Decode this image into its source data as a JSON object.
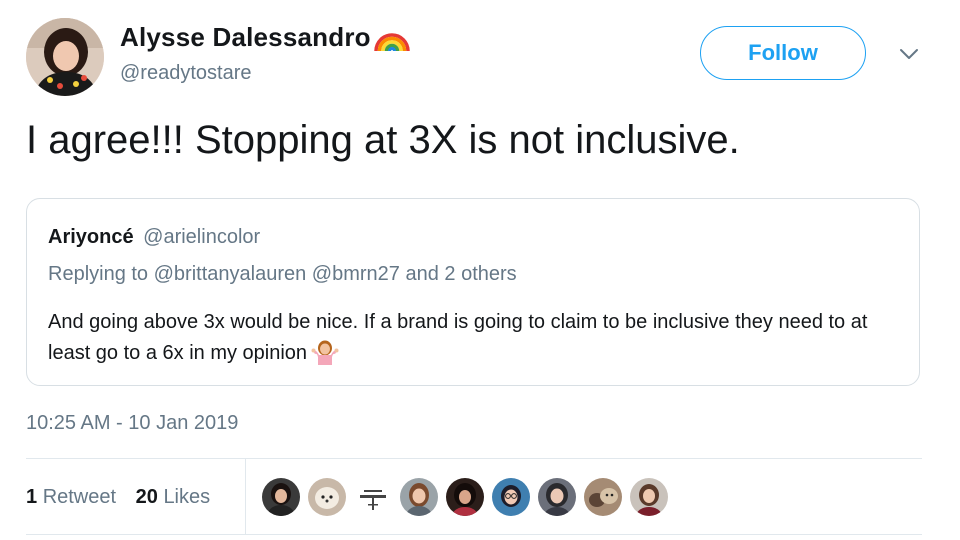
{
  "author": {
    "display_name": "Alysse Dalessandro",
    "handle": "@readytostare",
    "avatar_icon": "profile-photo",
    "name_emoji": "rainbow-icon"
  },
  "follow_label": "Follow",
  "tweet_text": "I agree!!! Stopping at 3X is not inclusive.",
  "quoted": {
    "name": "Ariyoncé",
    "handle": "@arielincolor",
    "reply_prefix": "Replying to",
    "reply_user1": "@brittanyalauren",
    "reply_user2": "@bmrn27",
    "reply_suffix": "and 2 others",
    "text": "And going above 3x would be nice. If a brand is going to claim to be inclusive they need to at least go to a 6x in my opinion",
    "emoji": "person-shrugging-icon"
  },
  "timestamp": "10:25 AM - 10 Jan 2019",
  "stats": {
    "retweets_count": "1",
    "retweets_label": "Retweet",
    "likes_count": "20",
    "likes_label": "Likes"
  },
  "colors": {
    "accent": "#1da1f2",
    "secondary_text": "#657786",
    "primary_text": "#14171a",
    "border": "#e1e8ed"
  },
  "likers": [
    {
      "icon": "liker-avatar-1"
    },
    {
      "icon": "liker-avatar-2"
    },
    {
      "icon": "liker-avatar-3"
    },
    {
      "icon": "liker-avatar-4"
    },
    {
      "icon": "liker-avatar-5"
    },
    {
      "icon": "liker-avatar-6"
    },
    {
      "icon": "liker-avatar-7"
    },
    {
      "icon": "liker-avatar-8"
    },
    {
      "icon": "liker-avatar-9"
    }
  ]
}
